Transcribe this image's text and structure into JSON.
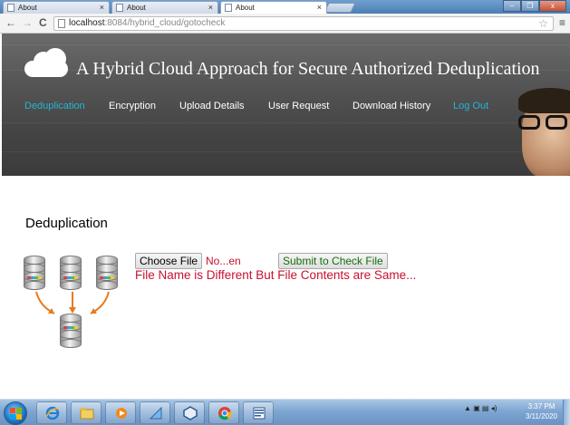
{
  "browser": {
    "tabs": [
      {
        "label": "About",
        "close": "×"
      },
      {
        "label": "About",
        "close": "×"
      },
      {
        "label": "About",
        "close": "×"
      }
    ],
    "window_buttons": {
      "minimize": "–",
      "maximize": "❐",
      "close": "x"
    },
    "nav": {
      "back": "←",
      "forward": "→",
      "reload": "C"
    },
    "address": {
      "host": "localhost",
      "path": ":8084/hybrid_cloud/gotocheck"
    },
    "star": "☆",
    "menu": "≡"
  },
  "site": {
    "title": "A Hybrid Cloud Approach for Secure Authorized Deduplication",
    "menu": [
      {
        "label": "Deduplication"
      },
      {
        "label": "Encryption"
      },
      {
        "label": "Upload Details"
      },
      {
        "label": "User Request"
      },
      {
        "label": "Download History"
      },
      {
        "label": "Log Out"
      }
    ]
  },
  "content": {
    "heading": "Deduplication",
    "choose_file_label": "Choose File",
    "file_name": "No...en",
    "submit_label": "Submit to Check File",
    "result": "File Name is Different But File Contents are Same..."
  },
  "taskbar": {
    "apps": [
      "internet-explorer",
      "file-explorer",
      "media-player",
      "tool",
      "virtualbox",
      "chrome",
      "word"
    ],
    "tray_icons": "▲ ▣ ▤ ◂) ",
    "time": "3:37 PM",
    "date": "3/11/2020"
  },
  "colors": {
    "active_menu": "#25b4d4",
    "error_text": "#c8102e",
    "submit_text": "#166c0e"
  }
}
